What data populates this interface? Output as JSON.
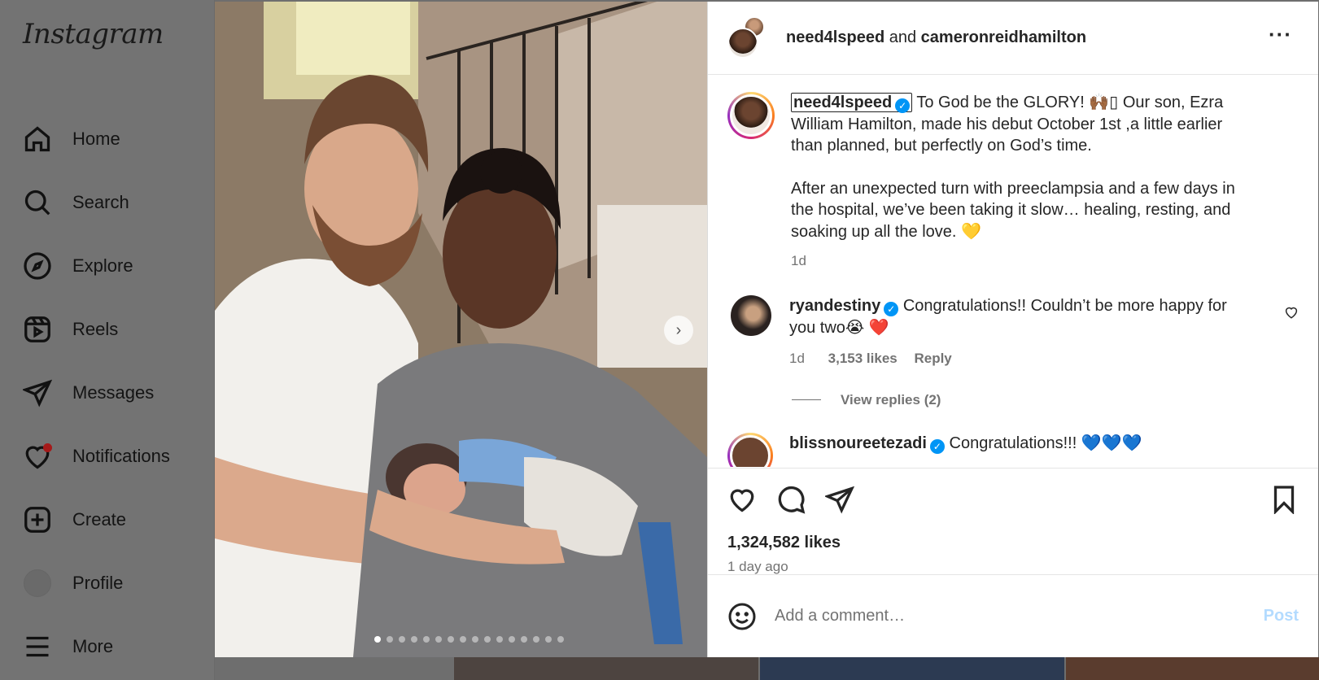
{
  "sidebar": {
    "logo": "Instagram",
    "items": [
      {
        "label": "Home",
        "icon": "home-icon"
      },
      {
        "label": "Search",
        "icon": "search-icon"
      },
      {
        "label": "Explore",
        "icon": "compass-icon"
      },
      {
        "label": "Reels",
        "icon": "reels-icon"
      },
      {
        "label": "Messages",
        "icon": "send-icon"
      },
      {
        "label": "Notifications",
        "icon": "heart-icon"
      },
      {
        "label": "Create",
        "icon": "plus-square-icon"
      },
      {
        "label": "Profile",
        "icon": "avatar"
      },
      {
        "label": "More",
        "icon": "menu-icon"
      }
    ]
  },
  "post": {
    "header": {
      "author": "need4lspeed",
      "connector": "and",
      "collaborator": "cameronreidhamilton"
    },
    "media": {
      "slide_count": 16,
      "active_slide": 1
    },
    "caption": {
      "username": "need4lspeed",
      "line1": "To God be the GLORY! 🙌🏾▯ Our son, Ezra William Hamilton, made his debut October 1st ,a little earlier than planned, but perfectly on God’s time.",
      "line2": "After an unexpected turn with preeclampsia and a few days in the hospital, we’ve been taking it slow… healing, resting, and soaking up all the love. 💛",
      "time": "1d"
    },
    "comments": [
      {
        "username": "ryandestiny",
        "text": "Congratulations!! Couldn’t be more happy for you two😭",
        "emoji_heart": "❤️",
        "time": "1d",
        "likes": "3,153 likes",
        "reply": "Reply",
        "view_replies": "View replies (2)"
      },
      {
        "username": "blissnoureetezadi",
        "text": "Congratulations!!! 💙💙💙"
      }
    ],
    "likes": "1,324,582 likes",
    "posted": "1 day ago",
    "add_comment_placeholder": "Add a comment…",
    "post_button": "Post"
  },
  "colors": {
    "verified": "#0095f6",
    "post_button_disabled": "#b3dbff",
    "notification_dot": "#ff3040"
  }
}
